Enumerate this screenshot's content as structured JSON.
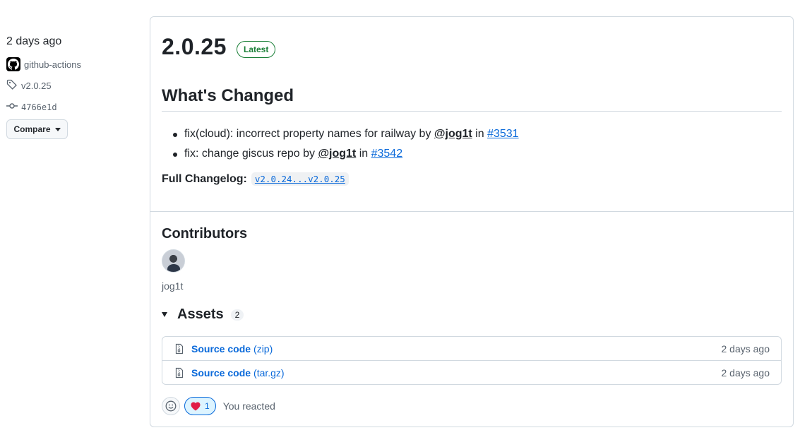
{
  "meta": {
    "time_ago": "2 days ago",
    "author": "github-actions",
    "tag": "v2.0.25",
    "commit": "4766e1d",
    "compare_label": "Compare"
  },
  "release": {
    "title": "2.0.25",
    "badge": "Latest",
    "heading": "What's Changed",
    "changes": [
      {
        "text": "fix(cloud): incorrect property names for railway by ",
        "mention": "@jog1t",
        "in": " in ",
        "pr": "#3531"
      },
      {
        "text": "fix: change giscus repo by ",
        "mention": "@jog1t",
        "in": " in ",
        "pr": "#3542"
      }
    ],
    "full_changelog_label": "Full Changelog",
    "full_changelog_colon": ":",
    "full_changelog_link": "v2.0.24...v2.0.25"
  },
  "contributors": {
    "title": "Contributors",
    "people": [
      {
        "name": "jog1t"
      }
    ]
  },
  "assets": {
    "title": "Assets",
    "count": "2",
    "items": [
      {
        "name": "Source code",
        "ext": "(zip)",
        "date": "2 days ago"
      },
      {
        "name": "Source code",
        "ext": "(tar.gz)",
        "date": "2 days ago"
      }
    ]
  },
  "reactions": {
    "heart_count": "1",
    "you_reacted": "You reacted"
  },
  "colors": {
    "accent": "#0969da",
    "success": "#1a7f37",
    "heart": "#e11d48"
  }
}
